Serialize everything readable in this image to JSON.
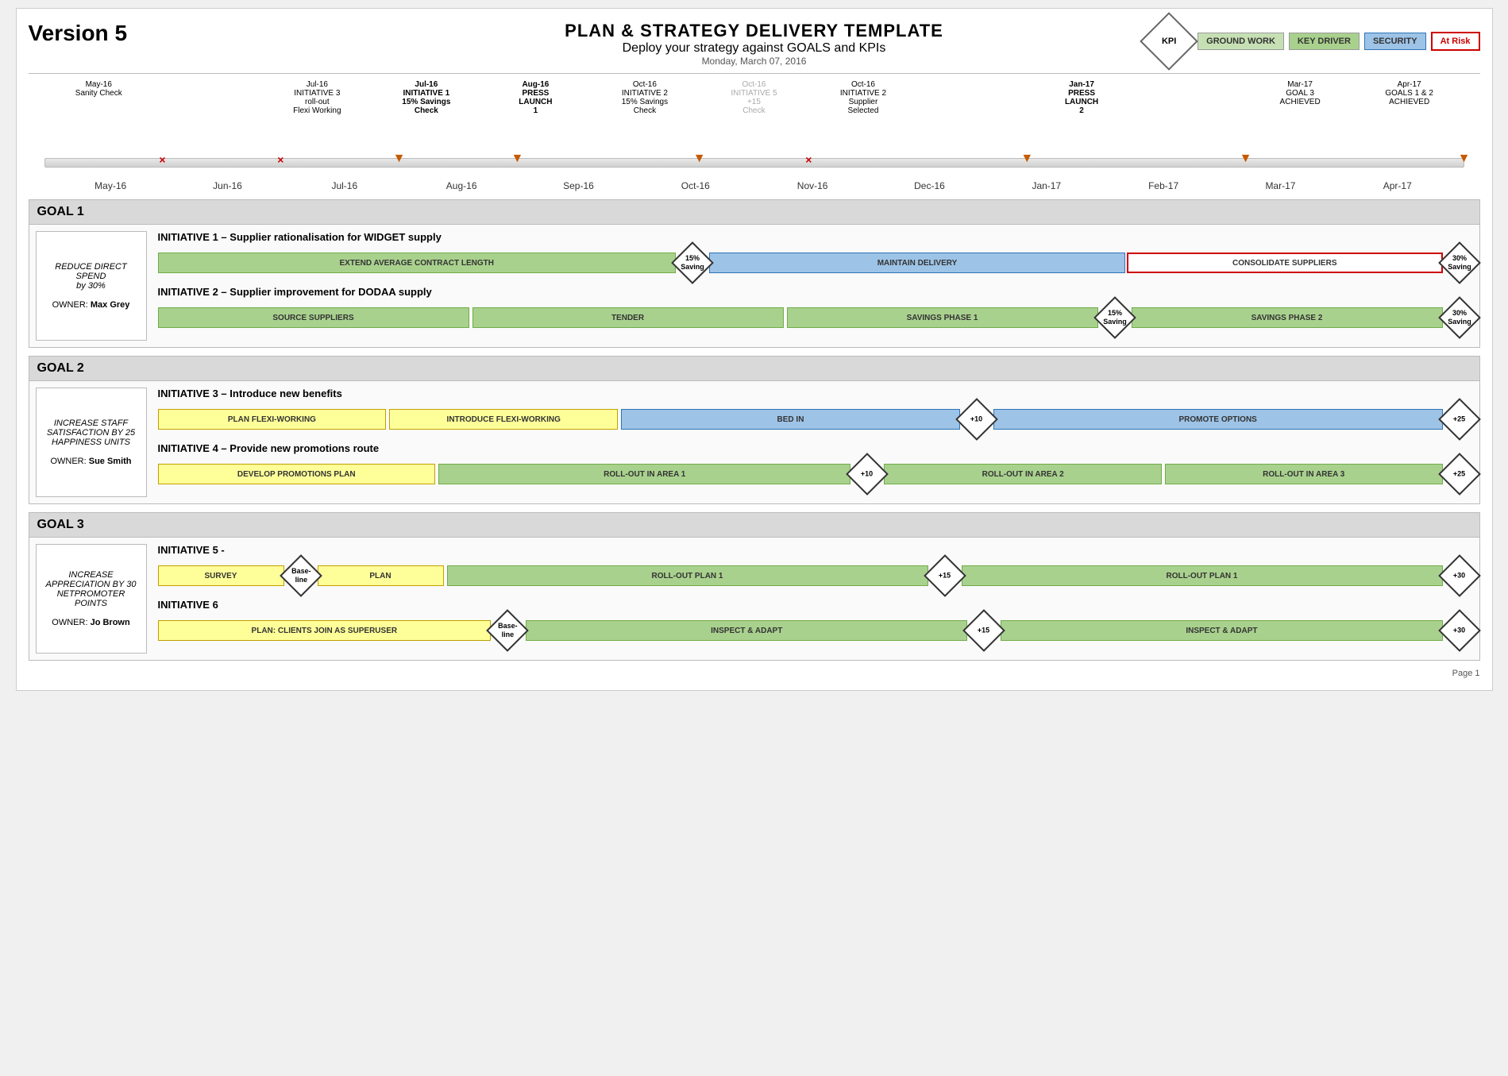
{
  "page": {
    "title": "PLAN & STRATEGY DELIVERY TEMPLATE",
    "subtitle": "Deploy your strategy against GOALS and KPIs",
    "date": "Monday, March 07, 2016",
    "version": "Version 5",
    "footer": "Page 1"
  },
  "legend": {
    "kpi": "KPI",
    "ground_work": "GROUND WORK",
    "key_driver": "KEY DRIVER",
    "security": "SECURITY",
    "at_risk": "At Risk"
  },
  "timeline": {
    "months": [
      "May-16",
      "Jun-16",
      "Jul-16",
      "Aug-16",
      "Sep-16",
      "Oct-16",
      "Nov-16",
      "Dec-16",
      "Jan-17",
      "Feb-17",
      "Mar-17",
      "Apr-17"
    ],
    "events": [
      {
        "date": "May-16",
        "label": "Sanity Check",
        "bold": false,
        "gray": false,
        "x": false,
        "arrow": false
      },
      {
        "date": "Jun-16",
        "label": "",
        "bold": false,
        "gray": false,
        "x": true,
        "arrow": false
      },
      {
        "date": "Jul-16",
        "label": "INITIATIVE 3\nroll-out\nFlexi Working",
        "bold": false,
        "gray": false,
        "x": true,
        "arrow": false
      },
      {
        "date": "Jul-16b",
        "label": "INITIATIVE 1\n15% Savings\nCheck",
        "bold": true,
        "gray": false,
        "x": false,
        "arrow": true
      },
      {
        "date": "Aug-16",
        "label": "PRESS\nLAUNCH\n1",
        "bold": true,
        "gray": false,
        "x": false,
        "arrow": true
      },
      {
        "date": "Oct-16a",
        "label": "INITIATIVE 2\n15% Savings\nCheck",
        "bold": false,
        "gray": false,
        "x": false,
        "arrow": true
      },
      {
        "date": "Oct-16b",
        "label": "INITIATIVE 5\n+15\nCheck",
        "bold": false,
        "gray": true,
        "x": true,
        "arrow": false
      },
      {
        "date": "Oct-16c",
        "label": "INITIATIVE 2\nSupplier\nSelected",
        "bold": false,
        "gray": false,
        "x": false,
        "arrow": false
      },
      {
        "date": "Jan-17",
        "label": "PRESS\nLAUNCH\n2",
        "bold": true,
        "gray": false,
        "x": false,
        "arrow": true
      },
      {
        "date": "Mar-17",
        "label": "GOAL 3\nACHIEVED",
        "bold": false,
        "gray": false,
        "x": false,
        "arrow": true
      },
      {
        "date": "Apr-17",
        "label": "GOALS 1 & 2\nACHIEVED",
        "bold": false,
        "gray": false,
        "x": false,
        "arrow": true
      }
    ]
  },
  "goals": [
    {
      "id": "goal1",
      "title": "GOAL 1",
      "sidebar": {
        "main": "REDUCE DIRECT SPEND by 30%",
        "owner_label": "OWNER:",
        "owner_name": "Max Grey"
      },
      "initiatives": [
        {
          "title": "INITIATIVE 1 – Supplier rationalisation for WIDGET supply",
          "phases": [
            {
              "label": "EXTEND AVERAGE CONTRACT LENGTH",
              "class": "bar-green",
              "flex": 5
            },
            {
              "label": "15%\nSaving",
              "class": "diamond",
              "value": "15%\nSaving"
            },
            {
              "label": "MAINTAIN DELIVERY",
              "class": "bar-blue",
              "flex": 4
            },
            {
              "label": "CONSOLIDATE SUPPLIERS",
              "class": "bar-red-outline",
              "flex": 3
            },
            {
              "label": "30%\nSaving",
              "class": "diamond",
              "value": "30%\nSaving"
            }
          ]
        },
        {
          "title": "INITIATIVE 2 – Supplier improvement for DODAA supply",
          "phases": [
            {
              "label": "SOURCE SUPPLIERS",
              "class": "bar-green",
              "flex": 3
            },
            {
              "label": "TENDER",
              "class": "bar-green",
              "flex": 3
            },
            {
              "label": "SAVINGS PHASE 1",
              "class": "bar-green",
              "flex": 3
            },
            {
              "label": "15%\nSaving",
              "class": "diamond",
              "value": "15%\nSaving"
            },
            {
              "label": "SAVINGS PHASE 2",
              "class": "bar-green",
              "flex": 3
            },
            {
              "label": "30%\nSaving",
              "class": "diamond",
              "value": "30%\nSaving"
            }
          ]
        }
      ]
    },
    {
      "id": "goal2",
      "title": "GOAL 2",
      "sidebar": {
        "main": "INCREASE STAFF SATISFACTION BY 25 HAPPINESS UNITS",
        "owner_label": "OWNER:",
        "owner_name": "Sue Smith"
      },
      "initiatives": [
        {
          "title": "INITIATIVE 3 – Introduce new benefits",
          "phases": [
            {
              "label": "PLAN FLEXI-WORKING",
              "class": "bar-yellow",
              "flex": 2
            },
            {
              "label": "INTRODUCE FLEXI-WORKING",
              "class": "bar-yellow",
              "flex": 2
            },
            {
              "label": "BED IN",
              "class": "bar-blue",
              "flex": 3
            },
            {
              "label": "+10",
              "class": "diamond",
              "value": "+10"
            },
            {
              "label": "PROMOTE OPTIONS",
              "class": "bar-blue",
              "flex": 4
            },
            {
              "label": "+25",
              "class": "diamond",
              "value": "+25"
            }
          ]
        },
        {
          "title": "INITIATIVE 4 – Provide new promotions route",
          "phases": [
            {
              "label": "DEVELOP PROMOTIONS PLAN",
              "class": "bar-yellow",
              "flex": 2
            },
            {
              "label": "ROLL-OUT IN AREA 1",
              "class": "bar-green",
              "flex": 3
            },
            {
              "label": "+10",
              "class": "diamond",
              "value": "+10"
            },
            {
              "label": "ROLL-OUT IN AREA 2",
              "class": "bar-green",
              "flex": 2
            },
            {
              "label": "ROLL-OUT IN AREA 3",
              "class": "bar-green",
              "flex": 2
            },
            {
              "label": "+25",
              "class": "diamond",
              "value": "+25"
            }
          ]
        }
      ]
    },
    {
      "id": "goal3",
      "title": "GOAL 3",
      "sidebar": {
        "main": "INCREASE APPRECIATION BY 30 NETPROMOTER POINTS",
        "owner_label": "OWNER:",
        "owner_name": "Jo Brown"
      },
      "initiatives": [
        {
          "title": "INITIATIVE 5 -",
          "phases": [
            {
              "label": "SURVEY",
              "class": "bar-yellow",
              "flex": 1
            },
            {
              "label": "Base-\nline",
              "class": "diamond",
              "value": "Base-\nline"
            },
            {
              "label": "PLAN",
              "class": "bar-yellow",
              "flex": 1
            },
            {
              "label": "ROLL-OUT PLAN 1",
              "class": "bar-green",
              "flex": 4
            },
            {
              "label": "+15",
              "class": "diamond",
              "value": "+15"
            },
            {
              "label": "ROLL-OUT PLAN 1",
              "class": "bar-green",
              "flex": 4
            },
            {
              "label": "+30",
              "class": "diamond",
              "value": "+30"
            }
          ]
        },
        {
          "title": "INITIATIVE 6",
          "phases": [
            {
              "label": "PLAN: CLIENTS JOIN AS SUPERUSER",
              "class": "bar-yellow",
              "flex": 3
            },
            {
              "label": "Base-\nline",
              "class": "diamond",
              "value": "Base-\nline"
            },
            {
              "label": "INSPECT & ADAPT",
              "class": "bar-green",
              "flex": 4
            },
            {
              "label": "+15",
              "class": "diamond",
              "value": "+15"
            },
            {
              "label": "INSPECT & ADAPT",
              "class": "bar-green",
              "flex": 4
            },
            {
              "label": "+30",
              "class": "diamond",
              "value": "+30"
            }
          ]
        }
      ]
    }
  ]
}
